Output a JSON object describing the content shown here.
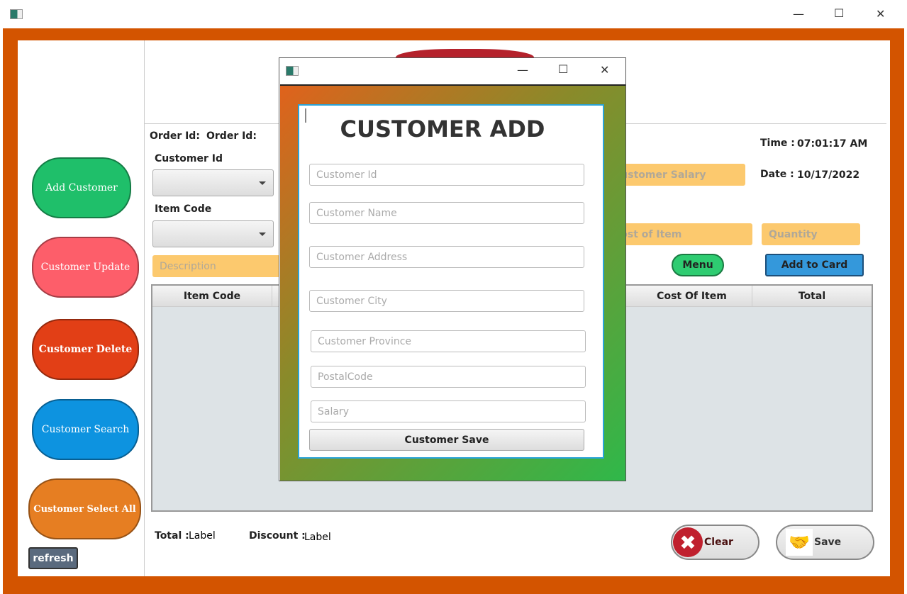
{
  "window": {
    "minimize": "—",
    "maximize": "☐",
    "close": "✕"
  },
  "sidebar": {
    "items": [
      {
        "label": "Add Customer",
        "color": "#1fbf6a"
      },
      {
        "label": "Customer Update",
        "color": "#fd5e6a"
      },
      {
        "label": "Customer Delete",
        "color": "#e23f16"
      },
      {
        "label": "Customer Search",
        "color": "#0d93e0"
      },
      {
        "label": "Customer Select All",
        "color": "#e67e22"
      }
    ],
    "refresh": "refresh"
  },
  "order": {
    "order_id_label": "Order Id:",
    "order_id_value": "Order Id:",
    "customer_id_label": "Customer Id",
    "item_code_label": "Item Code",
    "description_placeholder": "Description",
    "customer_salary_placeholder": "Customer Salary",
    "cost_of_item_placeholder": "Cost of Item",
    "quantity_placeholder": "Quantity",
    "menu": "Menu",
    "add_to_card": "Add  to Card"
  },
  "clock": {
    "time_label": "Time :",
    "time": "07:01:17 AM",
    "date_label": "Date :",
    "date": "10/17/2022"
  },
  "table": {
    "columns": [
      "Item Code",
      "",
      "",
      "",
      "Cost Of Item",
      "Total"
    ]
  },
  "footer": {
    "total_label": "Total :",
    "total_value": "Label",
    "discount_label": "Discount :",
    "discount_value": "Label",
    "clear": "Clear",
    "save": "Save"
  },
  "dialog": {
    "title": "CUSTOMER ADD",
    "fields": [
      "Customer Id",
      "Customer Name",
      "Customer Address",
      "Customer City",
      "Customer Province",
      "PostalCode",
      "Salary"
    ],
    "save": "Customer Save"
  }
}
